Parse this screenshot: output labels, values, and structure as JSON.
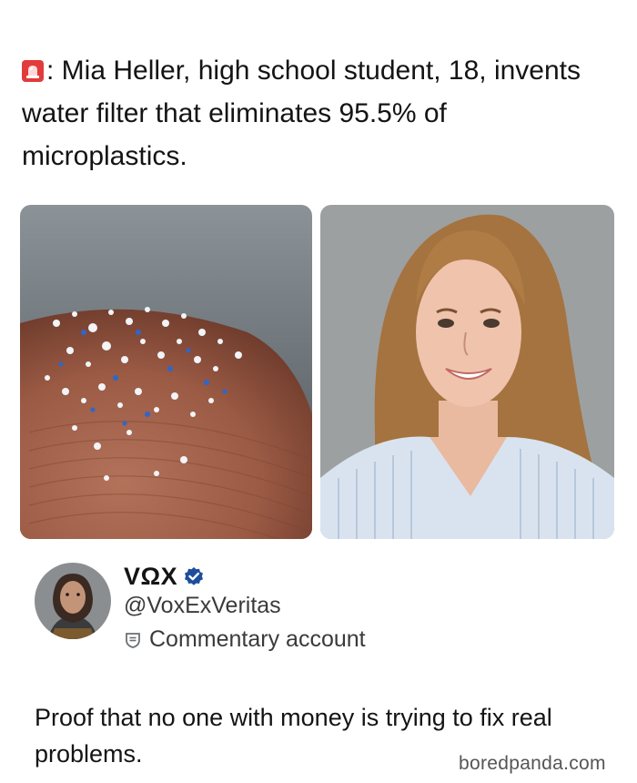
{
  "post": {
    "headline_icon": "siren-icon",
    "headline": ": Mia Heller, high school student, 18, invents water filter that eliminates 95.5% of microplastics."
  },
  "images": {
    "left": "microplastics-on-fingertip-photo",
    "right": "student-portrait-photo"
  },
  "author": {
    "display_name": "VΩX",
    "handle": "@VoxExVeritas",
    "account_type": "Commentary account",
    "verified_color": "#1d4e9e"
  },
  "tweet": {
    "text": "Proof that no one with money is trying to fix real problems."
  },
  "watermark": "boredpanda.com"
}
